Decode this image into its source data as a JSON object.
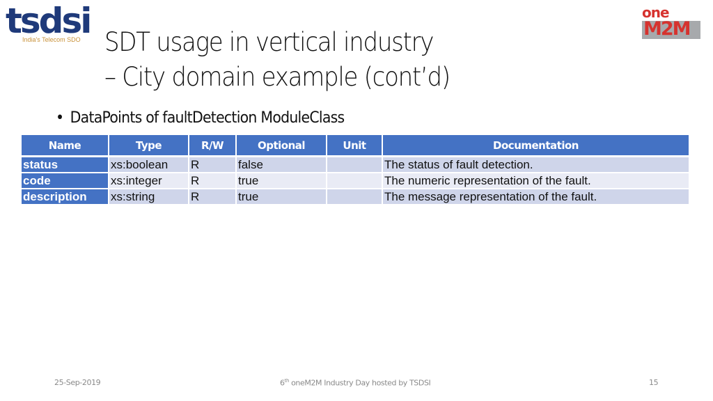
{
  "logos": {
    "left": {
      "name": "tsdsi",
      "tagline": "India's Telecom SDO",
      "color": "#1f3a7a",
      "tagline_color": "#c9923a"
    },
    "right": {
      "one": "one",
      "m2m_prefix": "M",
      "m2m_mid": "2",
      "m2m_suffix": "M",
      "color": "#d6322e",
      "gray": "#a7a9ac"
    }
  },
  "slide": {
    "title_line1": "SDT usage in vertical industry",
    "title_line2": "– City domain example (cont’d)",
    "bullet": "DataPoints of faultDetection ModuleClass"
  },
  "table": {
    "header_color": "#4472c4",
    "columns": [
      "Name",
      "Type",
      "R/W",
      "Optional",
      "Unit",
      "Documentation"
    ],
    "rows": [
      {
        "name": "status",
        "type": "xs:boolean",
        "rw": "R",
        "optional": "false",
        "unit": "",
        "doc": "The status of fault detection."
      },
      {
        "name": "code",
        "type": "xs:integer",
        "rw": "R",
        "optional": "true",
        "unit": "",
        "doc": "The numeric representation of the fault."
      },
      {
        "name": "description",
        "type": "xs:string",
        "rw": "R",
        "optional": "true",
        "unit": "",
        "doc": "The message representation of the fault."
      }
    ]
  },
  "footer": {
    "date": "25-Sep-2019",
    "center_sup_num": "6",
    "center_sup": "th",
    "center_text": " oneM2M Industry Day hosted by TSDSI",
    "page": "15"
  }
}
